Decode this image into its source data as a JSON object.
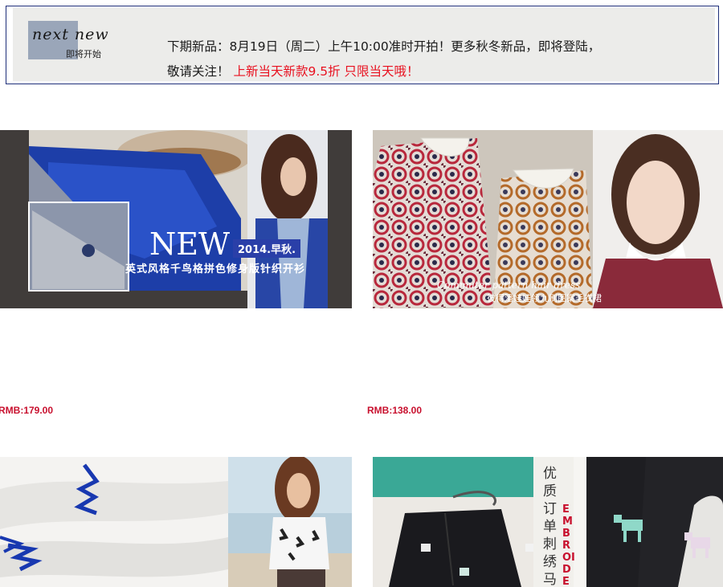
{
  "banner": {
    "logo_script": "next new",
    "logo_sub": "即将开始",
    "line1": "下期新品：8月19日（周二）上午10:00准时开拍！更多秋冬新品，即将登陆，",
    "line2_prefix": "敬请关注！",
    "line2_promo": "上新当天新款9.5折 只限当天哦！"
  },
  "products": [
    {
      "image_label": "product-image-knit-cardigan",
      "overlay_title": "NEW",
      "overlay_badge": "2014.早秋.",
      "overlay_caption": "英式风格千鸟格拼色修身版针织开衫",
      "price": "RMB:179.00"
    },
    {
      "image_label": "product-image-collar-dress",
      "overlay_caption_en": "Commuter pattern hair dress",
      "overlay_caption_cn": "彼得潘娃娃领九刷图案毛衣裙",
      "price": "RMB:138.00"
    },
    {
      "image_label": "product-image-palm-sweater"
    },
    {
      "image_label": "product-image-embroidered-cardigan",
      "overlay_vertical_cn": "优质订单 刺绣马 春",
      "overlay_vertical_en": "EMBROIDE"
    }
  ],
  "colors": {
    "price": "#c8102e",
    "promo": "#e8101f",
    "banner_bg": "#ececea",
    "banner_border": "#1f2f7a"
  }
}
